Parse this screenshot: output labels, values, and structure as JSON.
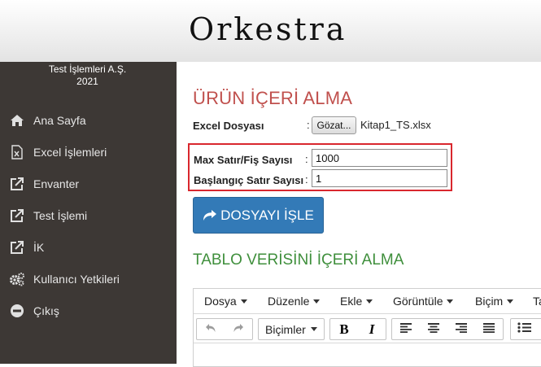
{
  "header": {
    "brand": "Orkestra"
  },
  "sidebar": {
    "company_name": "Test İşlemleri A.Ş.",
    "company_year": "2021",
    "items": [
      {
        "label": "Ana Sayfa",
        "icon": "home-icon"
      },
      {
        "label": "Excel İşlemleri",
        "icon": "excel-file-icon"
      },
      {
        "label": "Envanter",
        "icon": "external-link-icon"
      },
      {
        "label": "Test İşlemi",
        "icon": "external-link-icon"
      },
      {
        "label": "İK",
        "icon": "external-link-icon"
      },
      {
        "label": "Kullanıcı Yetkileri",
        "icon": "cogs-icon"
      },
      {
        "label": "Çıkış",
        "icon": "minus-circle-icon"
      }
    ]
  },
  "main": {
    "title": "ÜRÜN İÇERİ ALMA",
    "excel_label": "Excel Dosyası",
    "colon": ":",
    "browse_button": "Gözat...",
    "file_name": "Kitap1_TS.xlsx",
    "max_rows_label": "Max Satır/Fiş Sayısı",
    "max_rows_value": "1000",
    "start_row_label": "Başlangıç Satır Sayısı",
    "start_row_value": "1",
    "process_button": "DOSYAYI İŞLE",
    "table_section_title": "TABLO VERİSİNİ İÇERİ ALMA"
  },
  "editor": {
    "menu": [
      "Dosya",
      "Düzenle",
      "Ekle",
      "Görüntüle",
      "Biçim",
      "Ta"
    ],
    "formats_label": "Biçimler",
    "bold": "B",
    "italic": "I"
  },
  "colors": {
    "sidebar_bg": "#3d3835",
    "title_red": "#c0504d",
    "section_green": "#3f8f3c",
    "primary_blue": "#337ab7",
    "highlight_red": "#d9272e"
  }
}
